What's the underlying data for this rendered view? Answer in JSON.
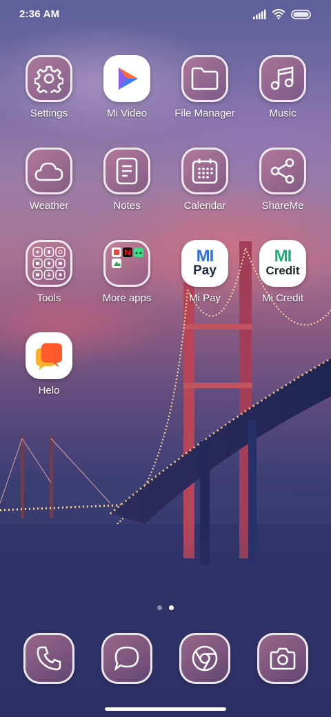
{
  "status_bar": {
    "time": "2:36 AM",
    "icons": [
      "signal-icon",
      "wifi-icon",
      "battery-icon"
    ]
  },
  "apps": {
    "settings": "Settings",
    "mi_video": "Mi Video",
    "file_manager": "File Manager",
    "music": "Music",
    "weather": "Weather",
    "notes": "Notes",
    "calendar": "Calendar",
    "shareme": "ShareMe",
    "tools": "Tools",
    "more_apps": "More apps",
    "mi_pay": "Mi Pay",
    "mi_credit": "Mi Credit",
    "helo": "Helo"
  },
  "app_icon_text": {
    "mi_pay_top": "MI",
    "mi_pay_bottom": "Pay",
    "mi_credit_top": "MI",
    "mi_credit_bottom": "Credit"
  },
  "pager": {
    "pages": 2,
    "current": 2
  },
  "dock": [
    "phone-icon",
    "messages-icon",
    "browser-icon",
    "camera-icon"
  ],
  "colors": {
    "tile_border": "#ffffff",
    "mi_pay_blue": "#2f6fd8",
    "mi_credit_green": "#1bb07a",
    "helo_orange": "#ff6a2b"
  }
}
